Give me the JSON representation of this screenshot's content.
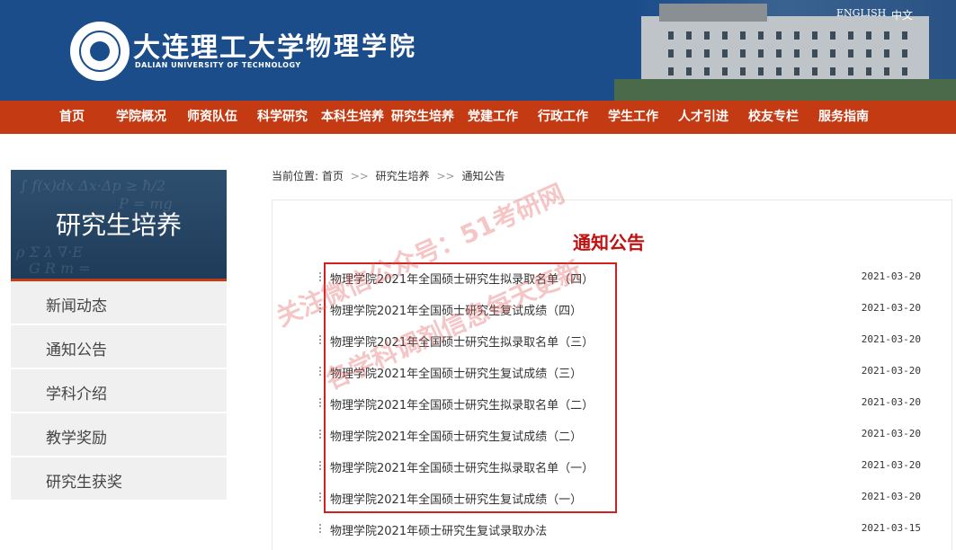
{
  "header": {
    "university_name": "大连理工大学",
    "university_en": "DALIAN UNIVERSITY OF TECHNOLOGY",
    "department": "物理学院",
    "lang_en": "ENGLISH",
    "lang_zh": "中文"
  },
  "nav": [
    "首页",
    "学院概况",
    "师资队伍",
    "科学研究",
    "本科生培养",
    "研究生培养",
    "党建工作",
    "行政工作",
    "学生工作",
    "人才引进",
    "校友专栏",
    "服务指南"
  ],
  "sidebar": {
    "banner_title": "研究生培养",
    "items": [
      "新闻动态",
      "通知公告",
      "学科介绍",
      "教学奖励",
      "研究生获奖"
    ]
  },
  "breadcrumb": {
    "prefix": "当前位置:",
    "items": [
      "首页",
      "研究生培养",
      "通知公告"
    ],
    "separator": ">>"
  },
  "content": {
    "title": "通知公告",
    "notices": [
      {
        "title": "物理学院2021年全国硕士研究生拟录取名单（四）",
        "date": "2021-03-20"
      },
      {
        "title": "物理学院2021年全国硕士研究生复试成绩（四）",
        "date": "2021-03-20"
      },
      {
        "title": "物理学院2021年全国硕士研究生拟录取名单（三）",
        "date": "2021-03-20"
      },
      {
        "title": "物理学院2021年全国硕士研究生复试成绩（三）",
        "date": "2021-03-20"
      },
      {
        "title": "物理学院2021年全国硕士研究生拟录取名单（二）",
        "date": "2021-03-20"
      },
      {
        "title": "物理学院2021年全国硕士研究生复试成绩（二）",
        "date": "2021-03-20"
      },
      {
        "title": "物理学院2021年全国硕士研究生拟录取名单（一）",
        "date": "2021-03-20"
      },
      {
        "title": "物理学院2021年全国硕士研究生复试成绩（一）",
        "date": "2021-03-20"
      },
      {
        "title": "物理学院2021年硕士研究生复试录取办法",
        "date": "2021-03-15"
      }
    ]
  },
  "watermark": {
    "line1": "关注微信公众号：51考研网",
    "line2": "各学科调剂信息每天更新"
  },
  "colors": {
    "header_bg": "#1b4d8b",
    "nav_bg": "#c43a12",
    "title_red": "#c01010",
    "highlight_red": "#d02020"
  }
}
